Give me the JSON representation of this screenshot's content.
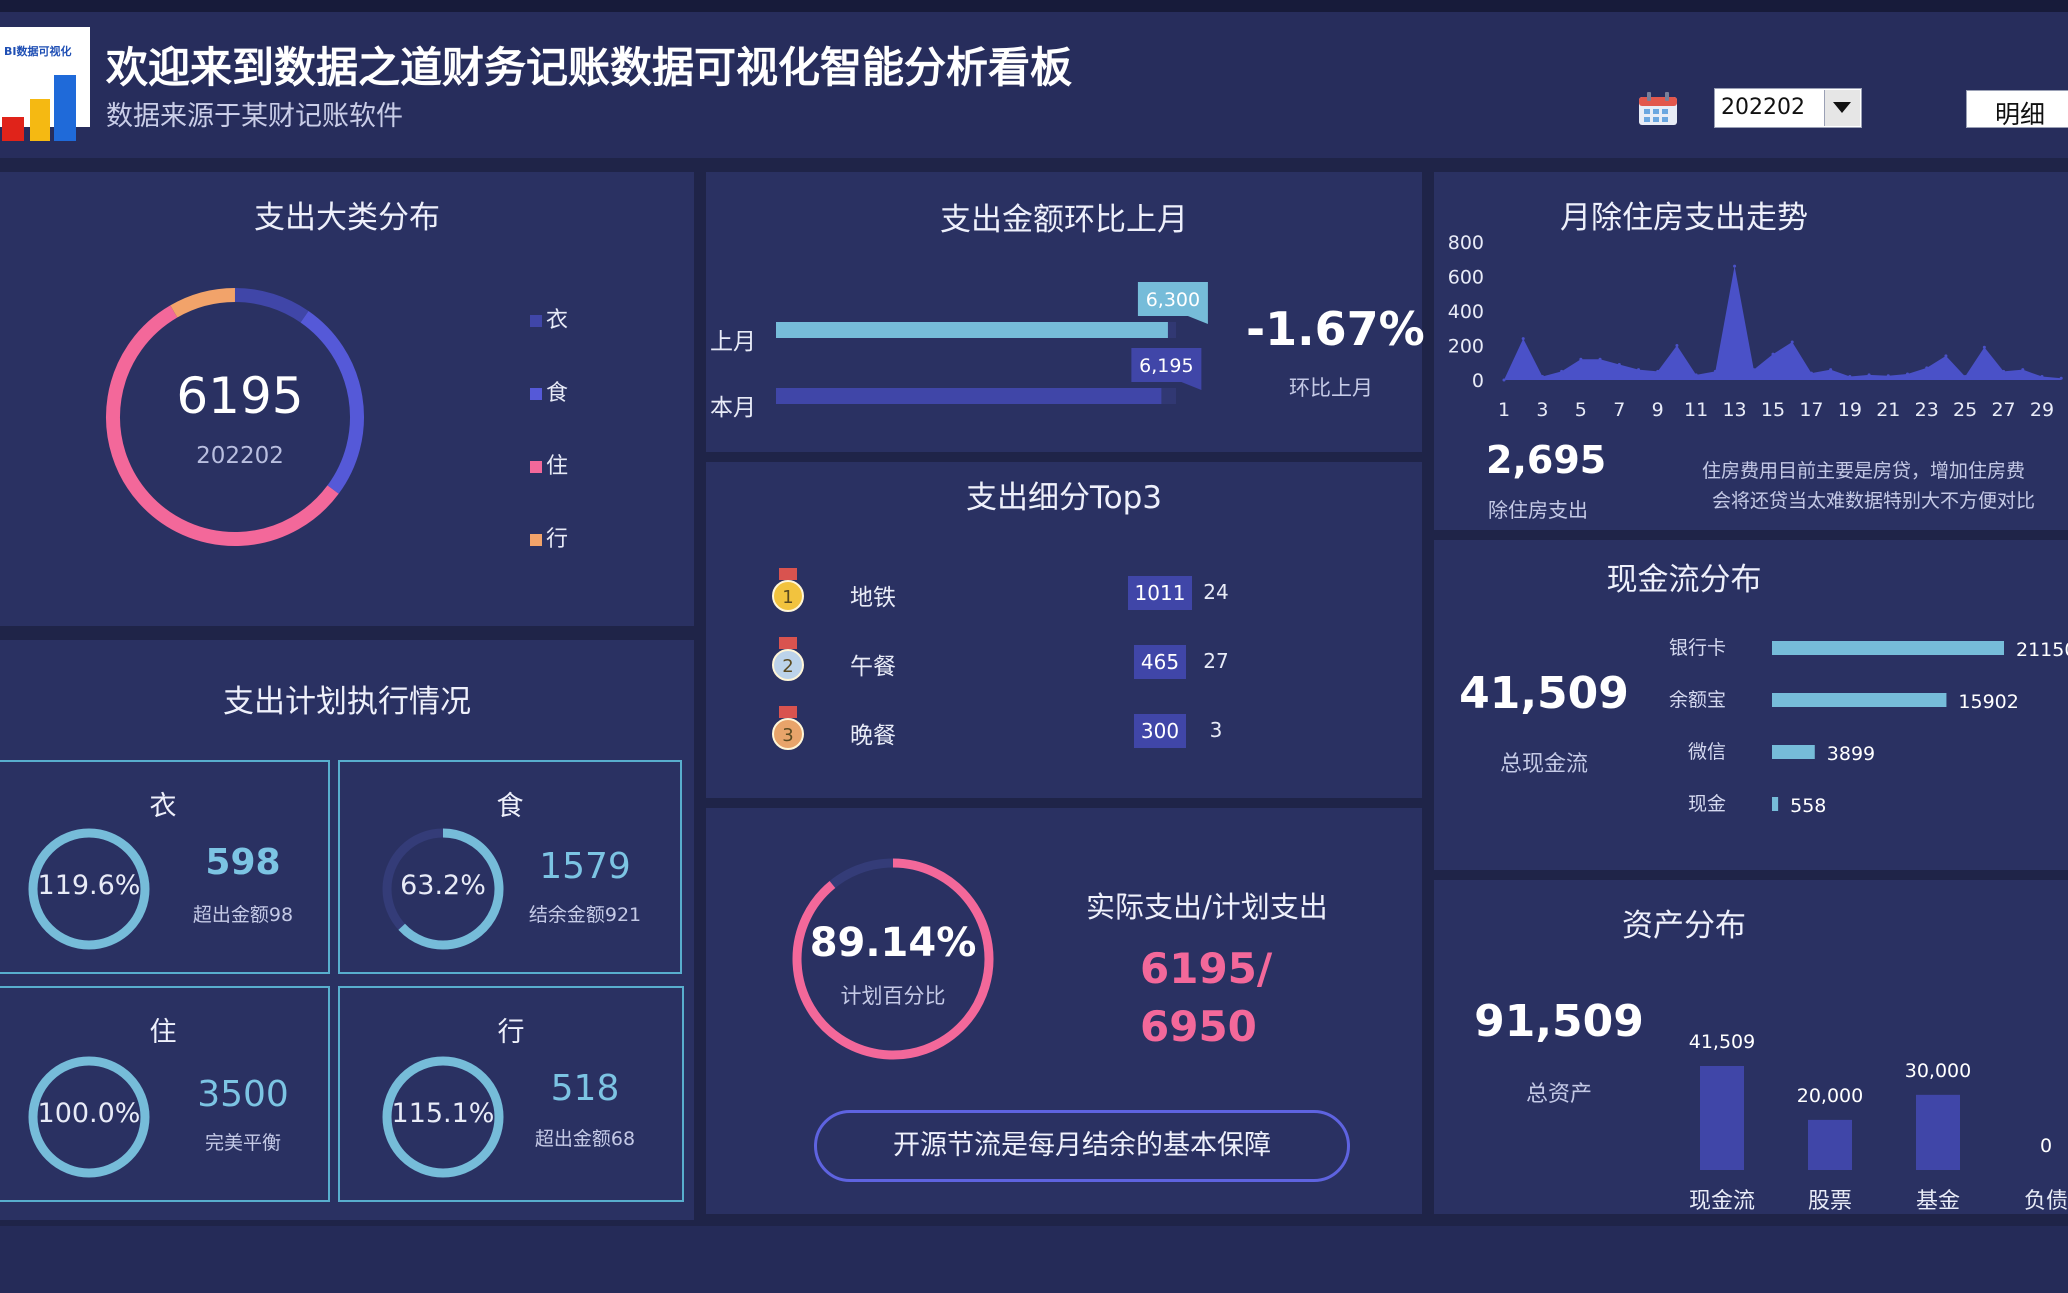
{
  "header": {
    "logo_text": "BI数据可视化",
    "title": "欢迎来到数据之道财务记账数据可视化智能分析看板",
    "subtitle": "数据来源于某财记账软件",
    "period_select": "202202",
    "detail_button": "明细"
  },
  "category": {
    "title": "支出大类分布",
    "total": "6195",
    "period": "202202",
    "legend": [
      "衣",
      "食",
      "住",
      "行"
    ],
    "colors": {
      "衣": "#4046a8",
      "食": "#5559d8",
      "住": "#f3689a",
      "行": "#f2a36a"
    }
  },
  "mom": {
    "title": "支出金额环比上月",
    "last_label": "上月",
    "this_label": "本月",
    "last_value_text": "6,300",
    "this_value_text": "6,195",
    "last_value": 6300,
    "this_value": 6195,
    "change": "-1.67%",
    "change_label": "环比上月"
  },
  "trend": {
    "title": "月除住房支出走势",
    "stat_value": "2,695",
    "stat_label": "除住房支出",
    "note_line1": "住房费用目前主要是房贷，增加住房费",
    "note_line2": "会将还贷当太难数据特别大不方便对比"
  },
  "top3": {
    "title": "支出细分Top3",
    "items": [
      {
        "rank": "1",
        "name": "地铁",
        "amount": "1011",
        "count": "24"
      },
      {
        "rank": "2",
        "name": "午餐",
        "amount": "465",
        "count": "27"
      },
      {
        "rank": "3",
        "name": "晚餐",
        "amount": "300",
        "count": "3"
      }
    ]
  },
  "cashflow": {
    "title": "现金流分布",
    "total": "41,509",
    "total_label": "总现金流"
  },
  "plan": {
    "title": "支出计划执行情况",
    "tiles": [
      {
        "name": "衣",
        "percent_text": "119.6%",
        "value": "598",
        "sub": "超出金额98"
      },
      {
        "name": "食",
        "percent_text": "63.2%",
        "value": "1579",
        "sub": "结余金额921"
      },
      {
        "name": "住",
        "percent_text": "100.0%",
        "value": "3500",
        "sub": "完美平衡"
      },
      {
        "name": "行",
        "percent_text": "115.1%",
        "value": "518",
        "sub": "超出金额68"
      }
    ]
  },
  "ratio": {
    "percent_text": "89.14%",
    "percent_label": "计划百分比",
    "heading": "实际支出/计划支出",
    "line1": "6195/",
    "line2": "6950",
    "slogan": "开源节流是每月结余的基本保障"
  },
  "assets": {
    "title": "资产分布",
    "total": "91,509",
    "total_label": "总资产"
  },
  "chart_data": [
    {
      "type": "pie",
      "title": "支出大类分布",
      "categories": [
        "衣",
        "食",
        "住",
        "行"
      ],
      "values": [
        598,
        1579,
        3500,
        518
      ]
    },
    {
      "type": "bar",
      "title": "支出金额环比上月",
      "categories": [
        "上月",
        "本月"
      ],
      "values": [
        6300,
        6195
      ]
    },
    {
      "type": "area",
      "title": "月除住房支出走势",
      "x": [
        1,
        2,
        3,
        4,
        5,
        6,
        7,
        8,
        9,
        10,
        11,
        12,
        13,
        14,
        15,
        16,
        17,
        18,
        19,
        20,
        21,
        22,
        23,
        24,
        25,
        26,
        27,
        28,
        29,
        30
      ],
      "values": [
        0,
        240,
        20,
        50,
        120,
        120,
        90,
        60,
        50,
        200,
        30,
        50,
        660,
        60,
        150,
        220,
        40,
        60,
        20,
        30,
        25,
        35,
        70,
        140,
        20,
        190,
        50,
        60,
        20,
        10
      ],
      "ylim": [
        0,
        800
      ],
      "yticks": [
        0,
        200,
        400,
        600,
        800
      ],
      "xticks": [
        1,
        3,
        5,
        7,
        9,
        11,
        13,
        15,
        17,
        19,
        21,
        23,
        25,
        27,
        29
      ],
      "color": "#4a51c8"
    },
    {
      "type": "bar",
      "title": "现金流分布",
      "orientation": "horizontal",
      "categories": [
        "银行卡",
        "余额宝",
        "微信",
        "现金"
      ],
      "values": [
        21150,
        15902,
        3899,
        558
      ],
      "color": "#76bcd9"
    },
    {
      "type": "bar",
      "title": "资产分布",
      "categories": [
        "现金流",
        "股票",
        "基金",
        "负债"
      ],
      "values": [
        41509,
        20000,
        30000,
        0
      ],
      "value_labels": [
        "41,509",
        "20,000",
        "30,000",
        "0"
      ],
      "color": "#4046a8"
    },
    {
      "type": "pie",
      "title": "计划百分比",
      "values": [
        89.14
      ],
      "max": 100
    }
  ]
}
